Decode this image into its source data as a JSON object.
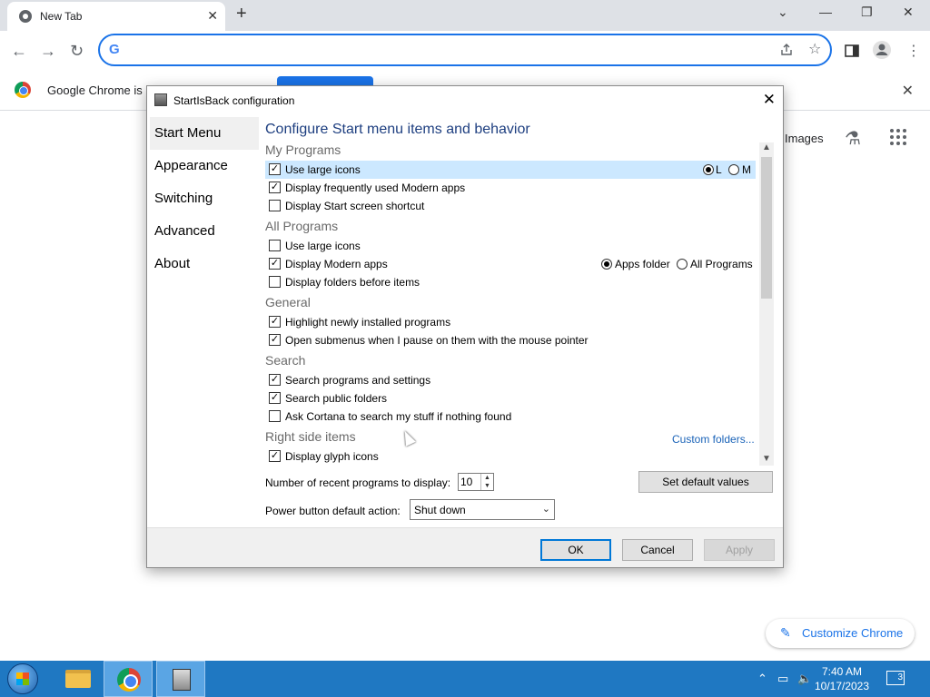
{
  "browser": {
    "tab_title": "New Tab",
    "tab_close": "✕",
    "new_tab": "+",
    "window_controls": [
      "⌄",
      "—",
      "❐",
      "✕"
    ],
    "omnibox_placeholder": "",
    "infobar_text": "Google Chrome is",
    "infobar_close": "✕"
  },
  "ntp": {
    "images_link": "Images",
    "customize_label": "Customize Chrome"
  },
  "dialog": {
    "title": "StartIsBack configuration",
    "close": "✕",
    "nav": [
      "Start Menu",
      "Appearance",
      "Switching",
      "Advanced",
      "About"
    ],
    "heading": "Configure Start menu items and behavior",
    "sections": {
      "my_programs": "My Programs",
      "all_programs": "All Programs",
      "general": "General",
      "search": "Search",
      "right_side": "Right side items"
    },
    "items": {
      "mp_large_icons": {
        "label": "Use large icons",
        "checked": true
      },
      "mp_modern_apps": {
        "label": "Display frequently used Modern apps",
        "checked": true
      },
      "mp_start_screen": {
        "label": "Display Start screen shortcut",
        "checked": false
      },
      "ap_large_icons": {
        "label": "Use large icons",
        "checked": false
      },
      "ap_modern_apps": {
        "label": "Display Modern apps",
        "checked": true
      },
      "ap_folders_before": {
        "label": "Display folders before items",
        "checked": false
      },
      "g_highlight": {
        "label": "Highlight newly installed programs",
        "checked": true
      },
      "g_submenus": {
        "label": "Open submenus when I pause on them with the mouse pointer",
        "checked": true
      },
      "s_programs": {
        "label": "Search programs and settings",
        "checked": true
      },
      "s_public": {
        "label": "Search public folders",
        "checked": true
      },
      "s_cortana": {
        "label": "Ask Cortana to search my stuff if nothing found",
        "checked": false
      },
      "r_glyph": {
        "label": "Display glyph icons",
        "checked": true
      }
    },
    "size_radios": {
      "l": "L",
      "m": "M",
      "selected": "L"
    },
    "apps_radios": {
      "apps_folder": "Apps folder",
      "all_programs": "All Programs",
      "selected": "Apps folder"
    },
    "custom_folders": "Custom folders...",
    "recent_label": "Number of recent programs to display:",
    "recent_value": "10",
    "set_default": "Set default values",
    "power_label": "Power button default action:",
    "power_value": "Shut down",
    "ok": "OK",
    "cancel": "Cancel",
    "apply": "Apply"
  },
  "taskbar": {
    "time": "7:40 AM",
    "date": "10/17/2023",
    "notifications": "3"
  }
}
